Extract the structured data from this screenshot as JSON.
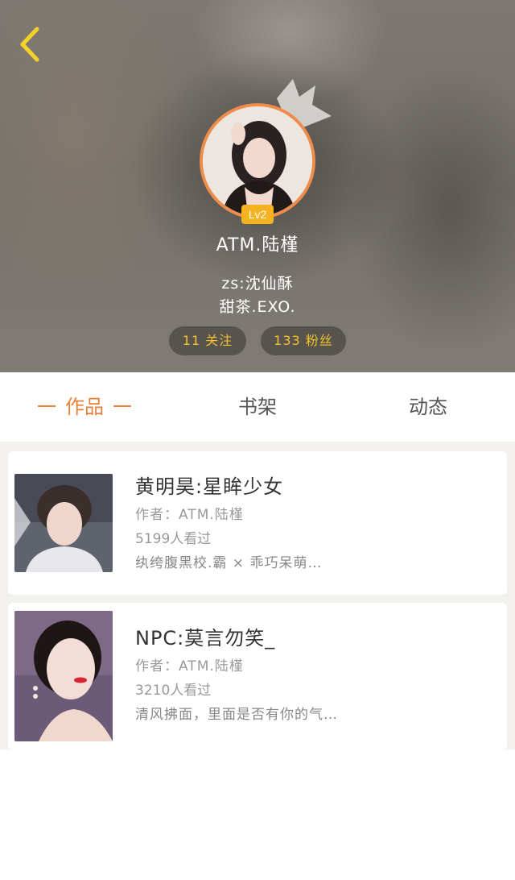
{
  "header": {
    "level": "Lv2",
    "user_name": "ATM.陆槿",
    "bio_line1": "zs:沈仙酥",
    "bio_line2": "甜茶.EXO.",
    "follow_stat": "11 关注",
    "fans_stat": "133 粉丝",
    "accent_color": "#f08c4a",
    "icons": [
      "back-arrow-icon",
      "crown-icon"
    ]
  },
  "tabs": [
    {
      "label": "作品",
      "active": true
    },
    {
      "label": "书架",
      "active": false
    },
    {
      "label": "动态",
      "active": false
    }
  ],
  "works": [
    {
      "title": "黄明昊:星眸少女",
      "author": "作者：ATM.陆槿",
      "views": "5199人看过",
      "description": "纨绔腹黑校.霸 × 乖巧呆萌…"
    },
    {
      "title": "NPC:莫言勿笑_",
      "author": "作者：ATM.陆槿",
      "views": "3210人看过",
      "description": "清风拂面，里面是否有你的气…"
    }
  ]
}
